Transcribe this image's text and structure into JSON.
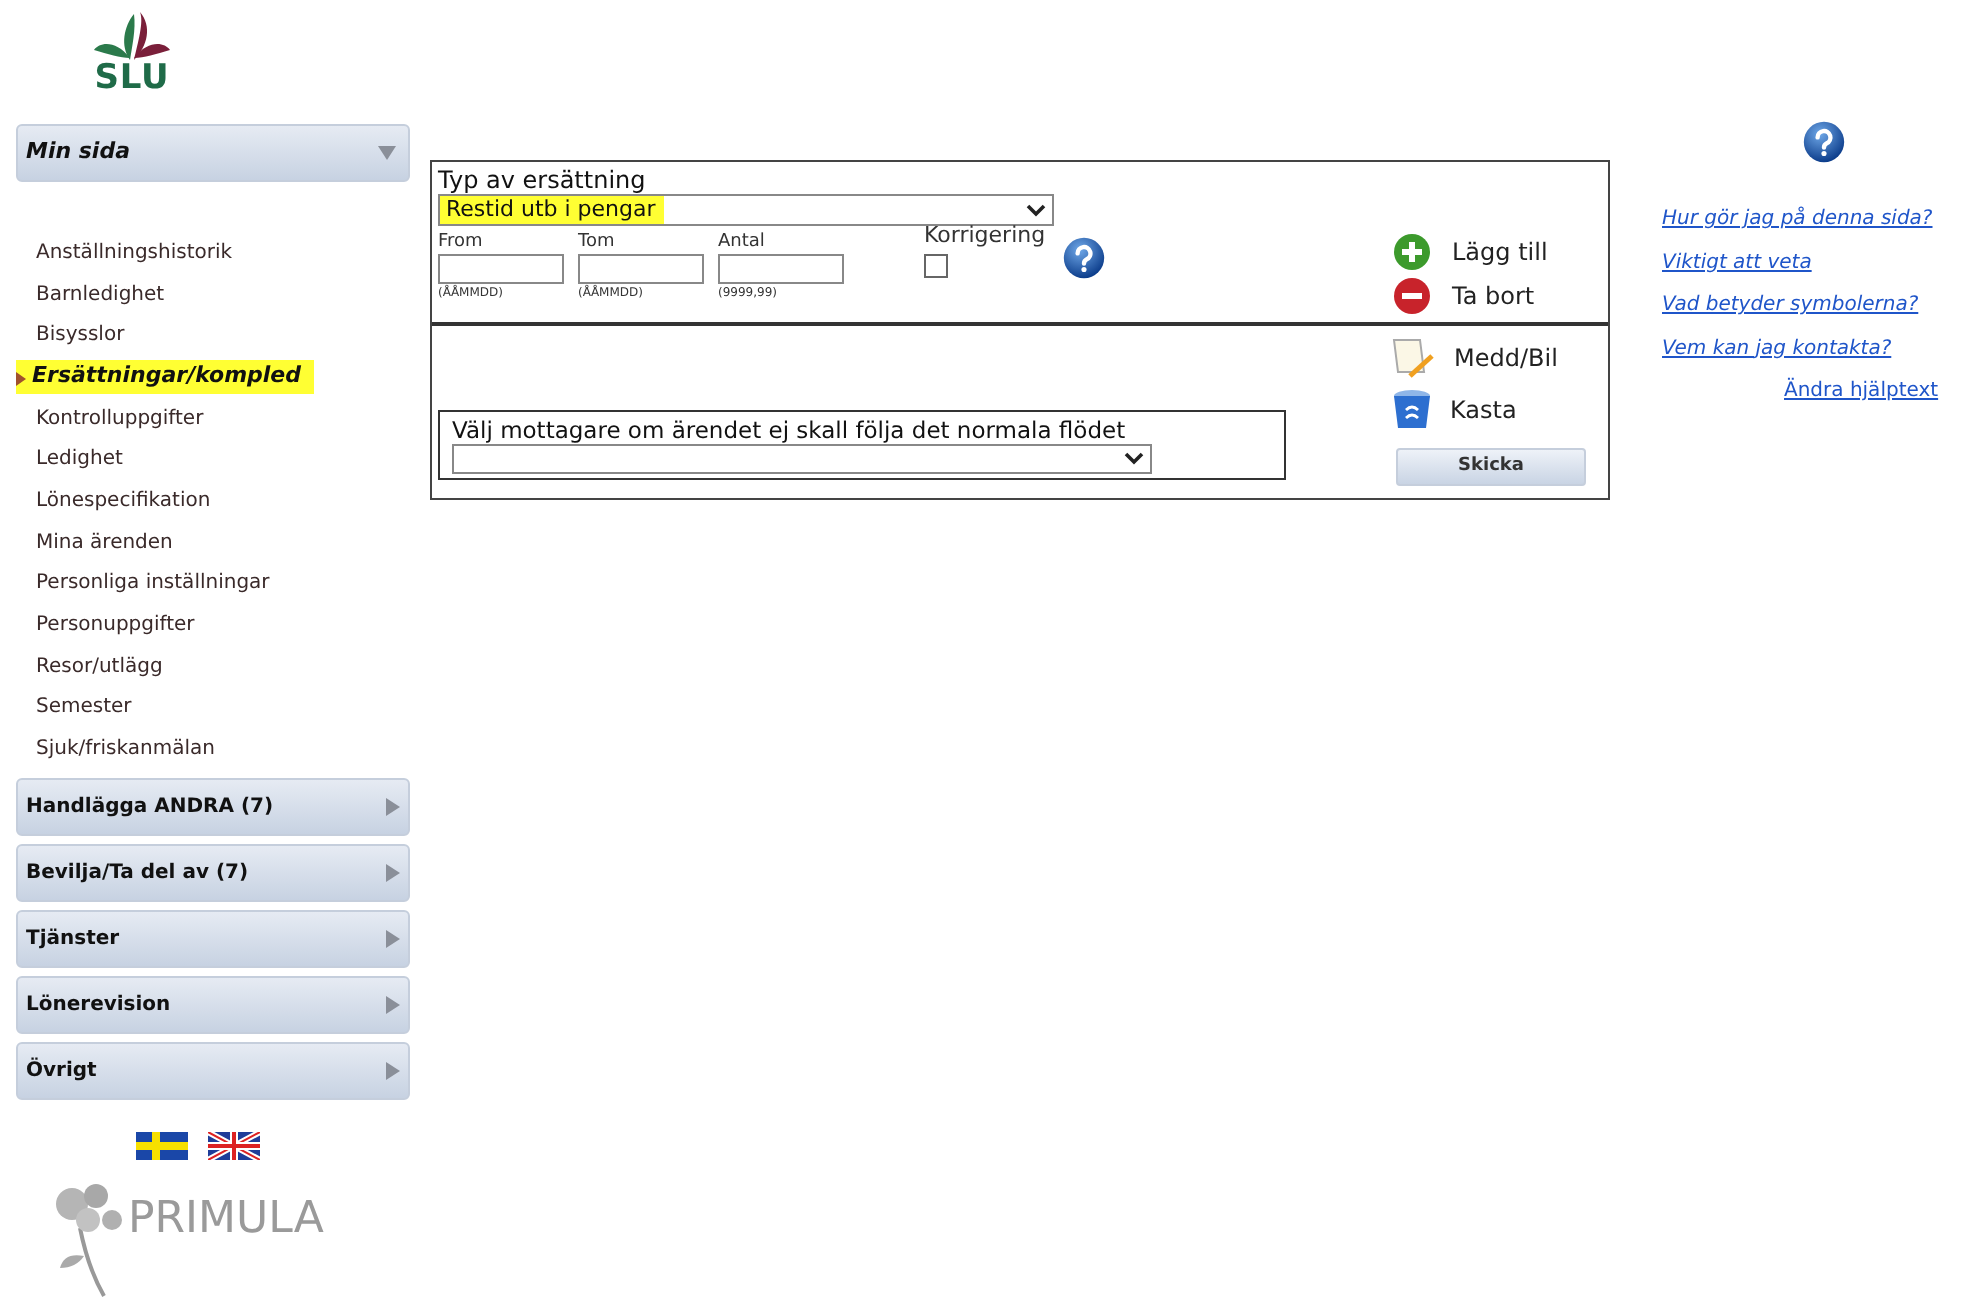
{
  "sidebar": {
    "header": {
      "label": "Min sida",
      "expanded": true
    },
    "items": [
      {
        "label": "Anställningshistorik",
        "selected": false
      },
      {
        "label": "Barnledighet",
        "selected": false
      },
      {
        "label": "Bisysslor",
        "selected": false
      },
      {
        "label": "Ersättningar/kompled",
        "selected": true
      },
      {
        "label": "Kontrolluppgifter",
        "selected": false
      },
      {
        "label": "Ledighet",
        "selected": false
      },
      {
        "label": "Lönespecifikation",
        "selected": false
      },
      {
        "label": "Mina ärenden",
        "selected": false
      },
      {
        "label": "Personliga inställningar",
        "selected": false
      },
      {
        "label": "Personuppgifter",
        "selected": false
      },
      {
        "label": "Resor/utlägg",
        "selected": false
      },
      {
        "label": "Semester",
        "selected": false
      },
      {
        "label": "Sjuk/friskanmälan",
        "selected": false
      }
    ],
    "panels": [
      {
        "label": "Handlägga ANDRA (7)",
        "expanded": false
      },
      {
        "label": "Bevilja/Ta del av (7)",
        "expanded": false
      },
      {
        "label": "Tjänster",
        "expanded": false
      },
      {
        "label": "Lönerevision",
        "expanded": false
      },
      {
        "label": "Övrigt",
        "expanded": false
      }
    ],
    "footer_logo": "PRIMULA"
  },
  "logo": "SLU",
  "form": {
    "type_label": "Typ av ersättning",
    "type_value": "Restid utb i pengar",
    "fields": [
      {
        "label": "From",
        "hint": "(ÅÅMMDD)"
      },
      {
        "label": "Tom",
        "hint": "(ÅÅMMDD)"
      },
      {
        "label": "Antal",
        "hint": "(9999,99)"
      }
    ],
    "correction": {
      "label": "Korrigering",
      "checked": false
    },
    "actions": [
      {
        "kind": "add",
        "label": "Lägg till"
      },
      {
        "kind": "remove",
        "label": "Ta bort"
      }
    ],
    "side_actions": [
      {
        "kind": "note",
        "label": "Medd/Bil"
      },
      {
        "kind": "trash",
        "label": "Kasta"
      }
    ],
    "recipient_label": "Välj mottagare om ärendet ej skall följa det normala flödet",
    "send": "Skicka"
  },
  "help": {
    "links": [
      "Hur gör jag på denna sida?",
      "Viktigt att veta",
      "Vad betyder symbolerna?",
      "Vem kan jag kontakta?"
    ],
    "edit_link": "Ändra hjälptext"
  }
}
